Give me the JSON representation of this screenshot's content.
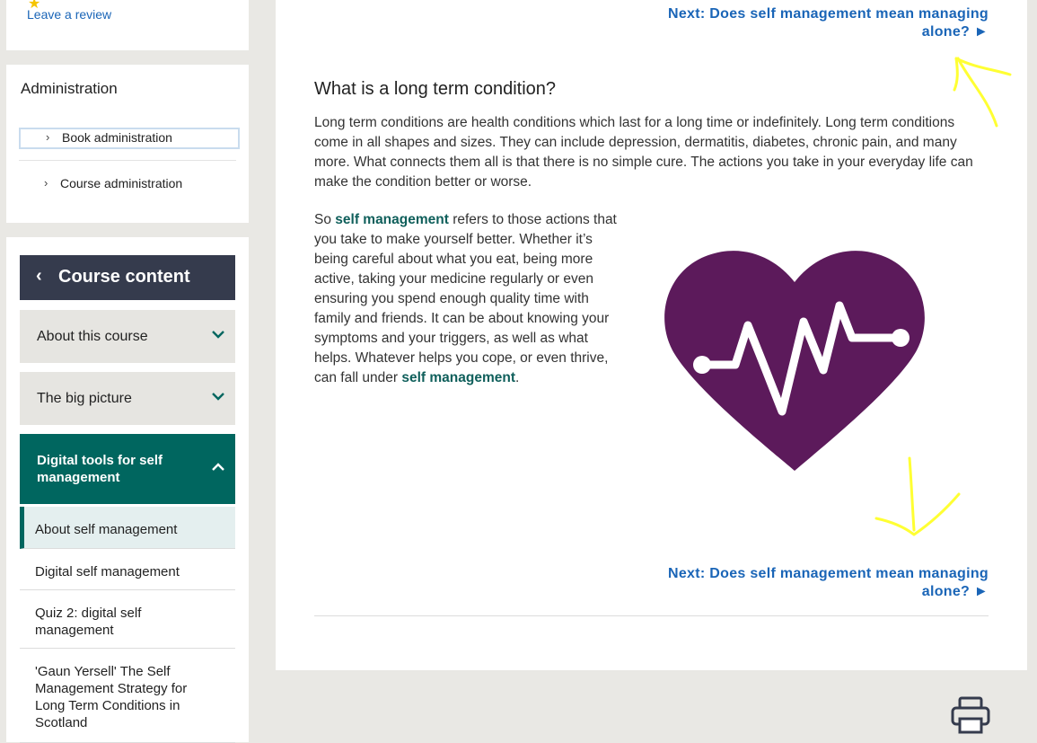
{
  "review": {
    "link": "Leave a review"
  },
  "admin": {
    "title": "Administration",
    "items": [
      "Book administration",
      "Course administration"
    ]
  },
  "course": {
    "header": "Course content",
    "sections": [
      {
        "label": "About this course",
        "expanded": false
      },
      {
        "label": "The big picture",
        "expanded": false
      },
      {
        "label": "Digital tools for self management",
        "expanded": true
      }
    ],
    "subitems": [
      "About self management",
      "Digital self management",
      "Quiz 2: digital self management",
      "'Gaun Yersell' The Self Management Strategy for Long Term Conditions in Scotland"
    ]
  },
  "main": {
    "next_prefix": "Next:",
    "next_title": "Does self management mean managing alone? ►",
    "heading": "What is a long term condition?",
    "para1": "Long term conditions are health conditions which last for a long time or indefinitely. Long term conditions come in all shapes and sizes. They can include depression, dermatitis, diabetes, chronic pain, and many more. What connects them all is that there is no simple cure. The actions you take in your everyday life can make the condition better or worse.",
    "para2_a": "So ",
    "para2_term1": "self management",
    "para2_b": " refers to those actions that you take to make yourself better. Whether it’s being careful about what you eat, being more active, taking your medicine regularly or even ensuring you spend enough quality time with family and friends. It can be about knowing your symptoms and your triggers, as well as what helps. Whatever helps you cope, or even thrive, can fall under ",
    "para2_term2": "self management",
    "para2_c": "."
  },
  "colors": {
    "teal": "#00665f",
    "navy": "#353b4d",
    "link": "#1a65b7",
    "heart": "#5c1a5b",
    "annotation": "#ffff33"
  }
}
